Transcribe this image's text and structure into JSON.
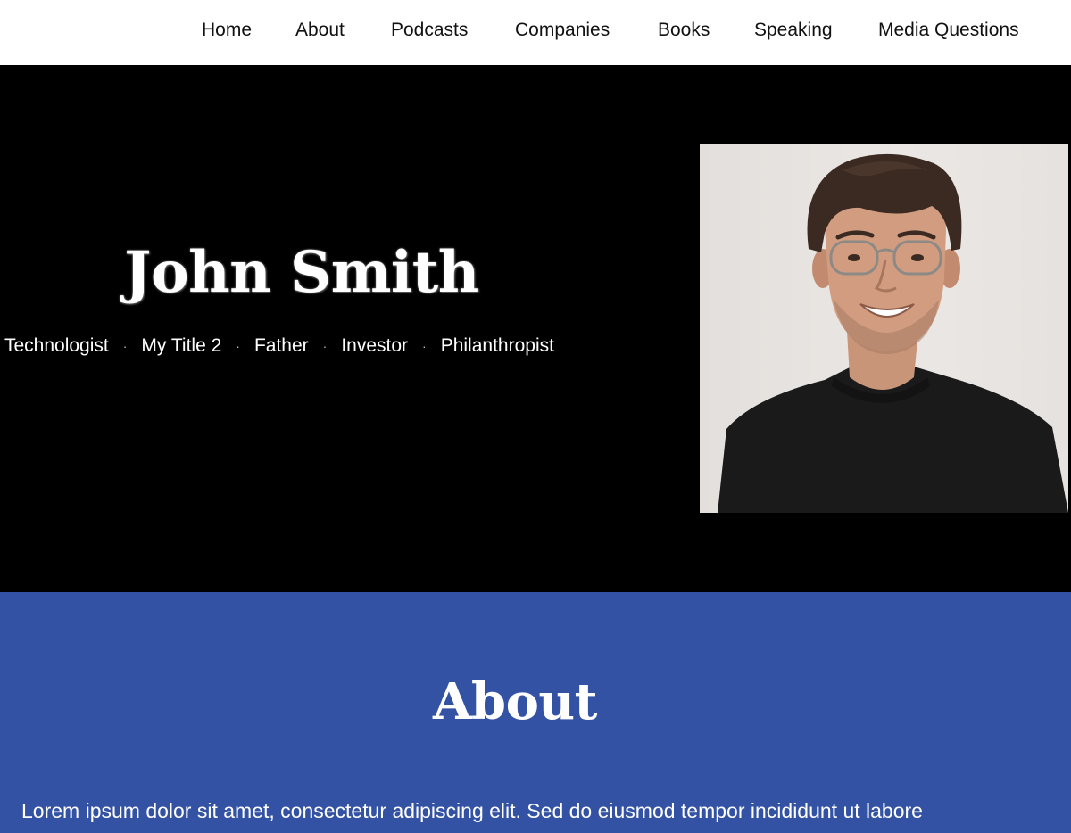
{
  "nav": {
    "items": [
      "Home",
      "About",
      "Podcasts",
      "Companies",
      "Books",
      "Speaking",
      "Media Questions"
    ]
  },
  "hero": {
    "name": "John Smith",
    "titles": [
      "Technologist",
      "My Title 2",
      "Father",
      "Investor",
      "Philanthropist"
    ],
    "separator": "·",
    "background": "#000000"
  },
  "about": {
    "heading": "About",
    "body": "Lorem ipsum dolor sit amet, consectetur adipiscing elit. Sed do eiusmod tempor incididunt ut labore",
    "background": "#3352a4"
  }
}
